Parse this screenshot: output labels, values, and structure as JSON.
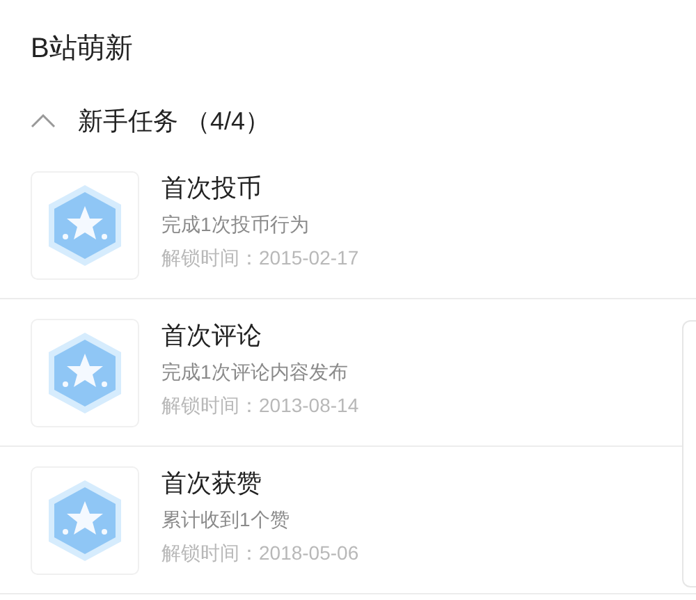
{
  "title": "B站萌新",
  "section": {
    "label": "新手任务 （4/4）",
    "expanded": true,
    "tasks": [
      {
        "name": "首次投币",
        "description": "完成1次投币行为",
        "unlock": "解锁时间：2015-02-17"
      },
      {
        "name": "首次评论",
        "description": "完成1次评论内容发布",
        "unlock": "解锁时间：2013-08-14"
      },
      {
        "name": "首次获赞",
        "description": "累计收到1个赞",
        "unlock": "解锁时间：2018-05-06"
      }
    ]
  }
}
